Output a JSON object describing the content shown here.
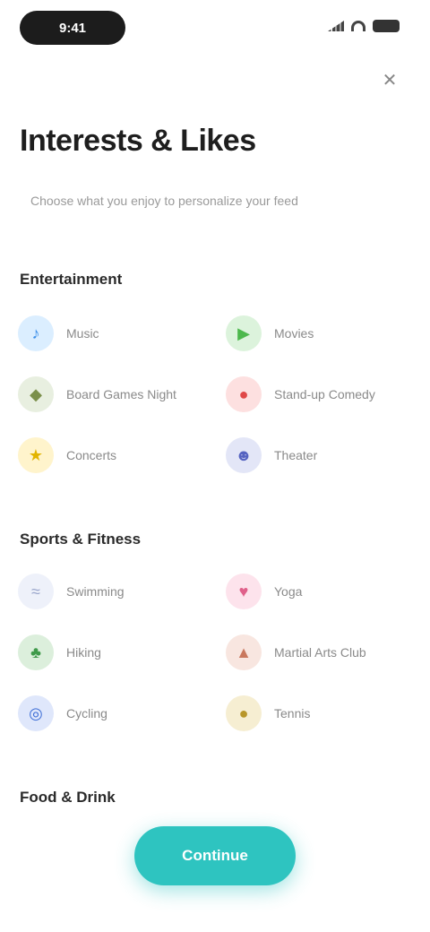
{
  "status_bar": {
    "time": "9:41"
  },
  "header": {
    "close_glyph": "✕",
    "title": "Interests & Likes",
    "subtitle": "Choose what you enjoy to personalize your feed"
  },
  "sections": [
    {
      "title": "Entertainment",
      "items": [
        {
          "label": "Music",
          "icon": "music-icon",
          "glyph": "♪",
          "bg": "#dbeeff",
          "fg": "#3a8ee8"
        },
        {
          "label": "Movies",
          "icon": "film-icon",
          "glyph": "▶",
          "bg": "#dcf3dc",
          "fg": "#4cb84c"
        },
        {
          "label": "Board Games Night",
          "icon": "dice-icon",
          "glyph": "◆",
          "bg": "#e8efe0",
          "fg": "#7a8f4a"
        },
        {
          "label": "Stand-up Comedy",
          "icon": "mic-icon",
          "glyph": "●",
          "bg": "#fde0e0",
          "fg": "#e04848"
        },
        {
          "label": "Concerts",
          "icon": "star-icon",
          "glyph": "★",
          "bg": "#fff4cc",
          "fg": "#e2b400"
        },
        {
          "label": "Theater",
          "icon": "mask-icon",
          "glyph": "☻",
          "bg": "#e3e6f7",
          "fg": "#5563c1"
        }
      ]
    },
    {
      "title": "Sports & Fitness",
      "items": [
        {
          "label": "Swimming",
          "icon": "wave-icon",
          "glyph": "≈",
          "bg": "#eef1fa",
          "fg": "#9aa6cc"
        },
        {
          "label": "Yoga",
          "icon": "heart-icon",
          "glyph": "♥",
          "bg": "#fde3ec",
          "fg": "#e0608a"
        },
        {
          "label": "Hiking",
          "icon": "leaf-icon",
          "glyph": "♣",
          "bg": "#dcefdc",
          "fg": "#3f9a4a"
        },
        {
          "label": "Martial Arts Club",
          "icon": "flame-icon",
          "glyph": "▲",
          "bg": "#f8e6e0",
          "fg": "#c9785e"
        },
        {
          "label": "Cycling",
          "icon": "bike-icon",
          "glyph": "◎",
          "bg": "#dfe7fb",
          "fg": "#3f6fd6"
        },
        {
          "label": "Tennis",
          "icon": "ball-icon",
          "glyph": "●",
          "bg": "#f6eed2",
          "fg": "#b8962a"
        }
      ]
    },
    {
      "title": "Food & Drink"
    }
  ],
  "cta": {
    "label": "Continue"
  }
}
